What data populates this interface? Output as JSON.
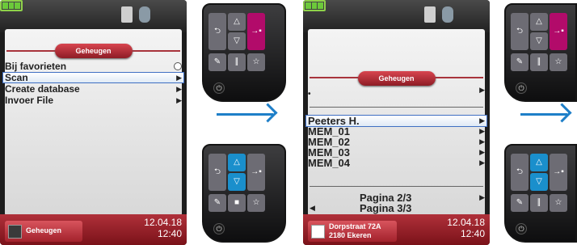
{
  "colors": {
    "accent_red": "#a8343c",
    "highlight_blue": "#1a8fcc",
    "magenta_key": "#b20b6a",
    "arrow_blue": "#1e7fc8"
  },
  "screen_a": {
    "title": "Geheugen",
    "menu": [
      {
        "label": "Bij favorieten",
        "indicator": "radio"
      },
      {
        "label": "Scan",
        "indicator": "arrow",
        "selected": true
      },
      {
        "label": "Create database",
        "indicator": "arrow"
      },
      {
        "label": "Invoer File",
        "indicator": "arrow"
      }
    ],
    "footer": {
      "label": "Geheugen",
      "date": "12.04.18",
      "time": "12:40"
    }
  },
  "screen_b": {
    "title": "Geheugen",
    "dot_item": "•",
    "menu": [
      {
        "label": "Peeters H.",
        "selected": true
      },
      {
        "label": "MEM_01"
      },
      {
        "label": "MEM_02"
      },
      {
        "label": "MEM_03"
      },
      {
        "label": "MEM_04"
      }
    ],
    "pager": [
      "Pagina 2/3",
      "Pagina 3/3"
    ],
    "footer": {
      "address_line1": "Dorpstraat 72A",
      "address_line2": "2180 Ekeren",
      "date": "12.04.18",
      "time": "12:40"
    }
  },
  "keypads": {
    "keys": {
      "back": "⮌",
      "up": "△",
      "down": "▽",
      "enter": "→▪",
      "edit": "✎",
      "pause": "∥",
      "star": "☆",
      "stop": "■",
      "power": "⏻"
    },
    "states": [
      {
        "id": "top-left",
        "highlight": "enter"
      },
      {
        "id": "bottom-left",
        "highlight": "up-down"
      },
      {
        "id": "top-right",
        "highlight": "enter"
      },
      {
        "id": "bottom-right",
        "highlight": "up-down"
      }
    ]
  }
}
